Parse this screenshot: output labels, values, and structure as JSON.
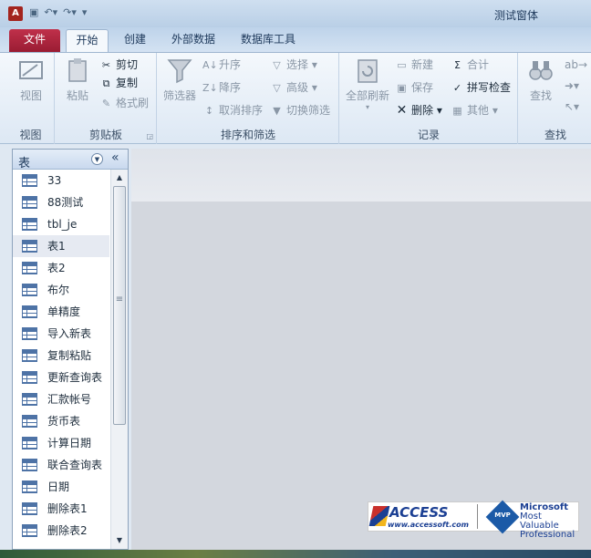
{
  "window": {
    "title": "测试窗体",
    "app_icon": "access-icon"
  },
  "tabs": [
    {
      "label": "文件"
    },
    {
      "label": "开始"
    },
    {
      "label": "创建"
    },
    {
      "label": "外部数据"
    },
    {
      "label": "数据库工具"
    }
  ],
  "ribbon": {
    "view": {
      "button": "视图",
      "group": "视图"
    },
    "clipboard": {
      "paste": "粘贴",
      "cut": "剪切",
      "copy": "复制",
      "format_painter": "格式刷",
      "group": "剪贴板"
    },
    "sort": {
      "filter": "筛选器",
      "ascending": "升序",
      "descending": "降序",
      "clear_sort": "取消排序",
      "selection": "选择",
      "advanced": "高级",
      "toggle_filter": "切换筛选",
      "group": "排序和筛选"
    },
    "records": {
      "refresh_all": "全部刷新",
      "new": "新建",
      "save": "保存",
      "delete": "删除",
      "totals": "合计",
      "spelling": "拼写检查",
      "more": "其他",
      "group": "记录"
    },
    "find": {
      "find": "查找",
      "group": "查找"
    }
  },
  "nav": {
    "title": "表",
    "items": [
      "33",
      "88测试",
      "tbl_je",
      "表1",
      "表2",
      "布尔",
      "单精度",
      "导入新表",
      "复制粘贴",
      "更新查询表",
      "汇款帐号",
      "货币表",
      "计算日期",
      "联合查询表",
      "日期",
      "删除表1",
      "删除表2"
    ],
    "selected": "表1"
  },
  "logo": {
    "access": "ACCESS",
    "url": "www.accessoft.com",
    "mvp": "MVP",
    "line1": "Microsoft",
    "line2": "Most Valuable",
    "line3": "Professional"
  }
}
